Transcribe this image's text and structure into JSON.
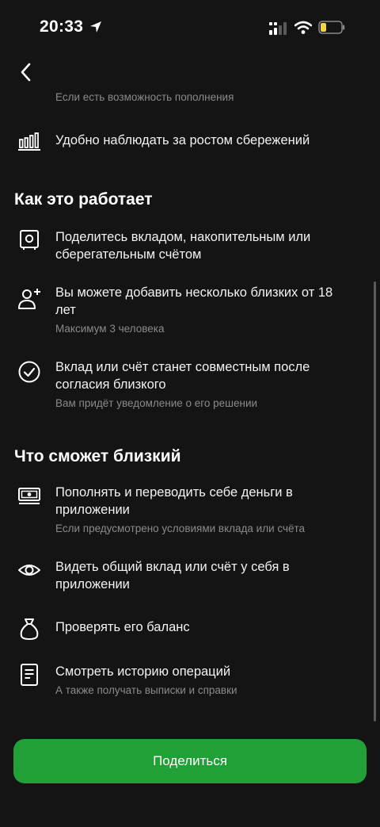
{
  "status_bar": {
    "time": "20:33"
  },
  "top_items": [
    {
      "title": "",
      "subtitle": "Если есть возможность пополнения"
    },
    {
      "title": "Удобно наблюдать за ростом сбережений",
      "icon": "chart-bars-icon"
    }
  ],
  "how_it_works": {
    "title": "Как это работает",
    "items": [
      {
        "title": "Поделитесь вкладом, накопительным или сберегательным счётом",
        "subtitle": "",
        "icon": "safe-icon"
      },
      {
        "title": "Вы можете добавить несколько близких от 18 лет",
        "subtitle": "Максимум 3 человека",
        "icon": "add-person-icon"
      },
      {
        "title": "Вклад или счёт станет совместным после согласия близкого",
        "subtitle": "Вам придёт уведомление о его решении",
        "icon": "check-circle-icon"
      }
    ]
  },
  "what_can": {
    "title": "Что сможет близкий",
    "items": [
      {
        "title": "Пополнять и переводить себе деньги в приложении",
        "subtitle": "Если предусмотрено условиями вклада или счёта",
        "icon": "banknote-icon"
      },
      {
        "title": "Видеть общий вклад или счёт у себя в приложении",
        "subtitle": "",
        "icon": "eye-icon"
      },
      {
        "title": "Проверять его баланс",
        "subtitle": "",
        "icon": "money-bag-icon"
      },
      {
        "title": "Смотреть историю операций",
        "subtitle": "А также получать выписки и справки",
        "icon": "document-icon"
      }
    ]
  },
  "share_button": {
    "label": "Поделиться"
  },
  "colors": {
    "background": "#141414",
    "accent": "#21a038",
    "secondary_text": "#8a8a8a"
  }
}
